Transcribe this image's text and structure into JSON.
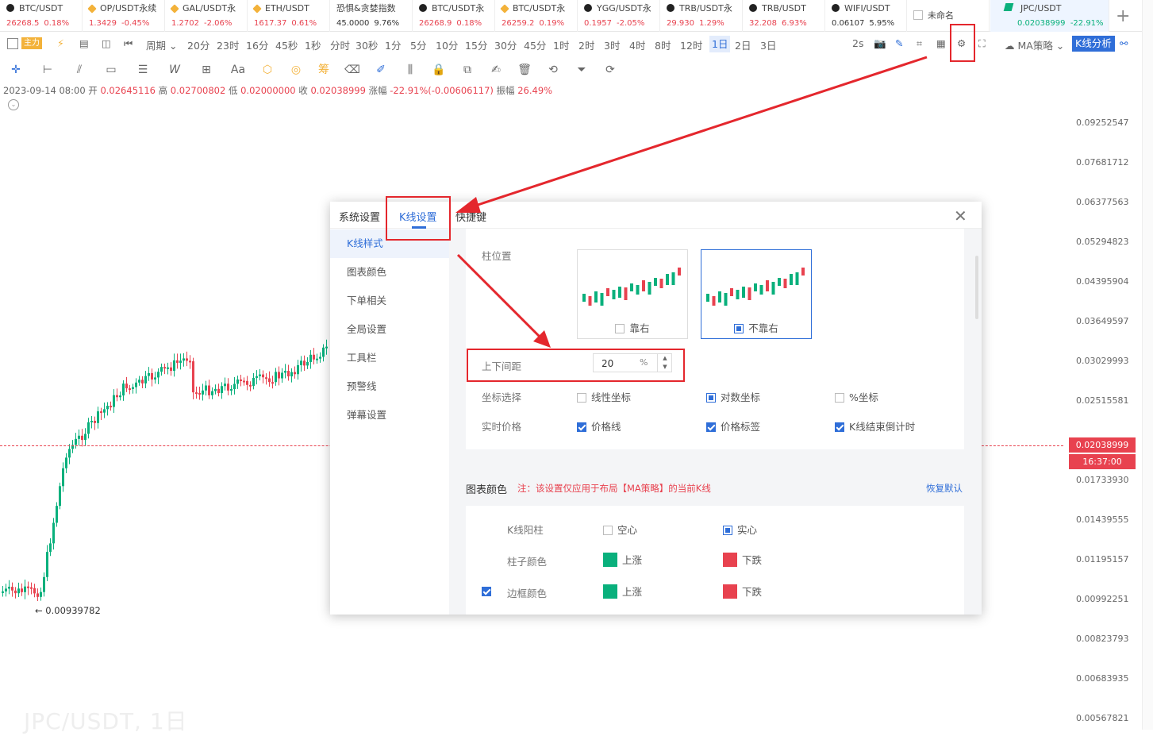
{
  "tickers": [
    {
      "name": "BTC/USDT",
      "price": "26268.5",
      "change": "0.18%",
      "icon": "black",
      "dir": "up"
    },
    {
      "name": "OP/USDT永续",
      "price": "1.3429",
      "change": "-0.45%",
      "icon": "gold",
      "dir": "down"
    },
    {
      "name": "GAL/USDT永",
      "price": "1.2702",
      "change": "-2.06%",
      "icon": "gold",
      "dir": "down"
    },
    {
      "name": "ETH/USDT",
      "price": "1617.37",
      "change": "0.61%",
      "icon": "gold",
      "dir": "up"
    },
    {
      "name": "恐惧&贪婪指数",
      "price": "45.0000",
      "change": "9.76%",
      "icon": "none",
      "dir": "neutral"
    },
    {
      "name": "BTC/USDT永",
      "price": "26268.9",
      "change": "0.18%",
      "icon": "black",
      "dir": "up"
    },
    {
      "name": "BTC/USDT永",
      "price": "26259.2",
      "change": "0.19%",
      "icon": "gold",
      "dir": "up"
    },
    {
      "name": "YGG/USDT永",
      "price": "0.1957",
      "change": "-2.05%",
      "icon": "black",
      "dir": "down"
    },
    {
      "name": "TRB/USDT永",
      "price": "29.930",
      "change": "1.29%",
      "icon": "black",
      "dir": "up"
    },
    {
      "name": "TRB/USDT",
      "price": "32.208",
      "change": "6.93%",
      "icon": "black",
      "dir": "up"
    },
    {
      "name": "WIFI/USDT",
      "price": "0.06107",
      "change": "5.95%",
      "icon": "black",
      "dir": "neutral"
    }
  ],
  "unnamed_label": "未命名",
  "active_ticker": {
    "name": "JPC/USDT",
    "price": "0.02038999",
    "change": "-22.91%"
  },
  "toolbar": {
    "main_badge": "主力",
    "period_label": "周期",
    "intervals": [
      "20分",
      "23时",
      "16分",
      "45秒",
      "1秒",
      "分时",
      "30秒",
      "1分",
      "5分",
      "10分",
      "15分",
      "30分",
      "45分",
      "1时",
      "2时",
      "3时",
      "4时",
      "8时",
      "12时",
      "1日",
      "2日",
      "3日"
    ],
    "selected_interval": "1日",
    "refresh": "2s",
    "strategy": "MA策略",
    "kline_analysis": "K线分析"
  },
  "draw_tools": {
    "text_tool": "Aa",
    "chip_tool": "筹"
  },
  "info": {
    "datetime": "2023-09-14 08:00",
    "open_label": "开",
    "open": "0.02645116",
    "high_label": "高",
    "high": "0.02700802",
    "low_label": "低",
    "low": "0.02000000",
    "close_label": "收",
    "close": "0.02038999",
    "chg_label": "涨幅",
    "chg": "-22.91%(-0.00606117)",
    "amp_label": "振幅",
    "amp": "26.49%"
  },
  "y_axis": [
    "0.09252547",
    "0.07681712",
    "0.06377563",
    "0.05294823",
    "0.04395904",
    "0.03649597",
    "0.03029993",
    "0.02515581",
    "0.01733930",
    "0.01439555",
    "0.01195157",
    "0.00992251",
    "0.00823793",
    "0.00683935",
    "0.00567821"
  ],
  "price_tag": "0.02038999",
  "countdown": "16:37:00",
  "low_marker": "← 0.00939782",
  "watermark": "JPC/USDT, 1日",
  "dialog": {
    "tabs": [
      "系统设置",
      "K线设置",
      "快捷键"
    ],
    "active_tab": "K线设置",
    "sidebar": [
      "K线样式",
      "图表颜色",
      "下单相关",
      "全局设置",
      "工具栏",
      "预警线",
      "弹幕设置"
    ],
    "active_side": "K线样式",
    "bar_position_label": "柱位置",
    "bar_pos_right": "靠右",
    "bar_pos_not_right": "不靠右",
    "spacing_label": "上下间距",
    "spacing_value": "20",
    "spacing_unit": "%",
    "coord_label": "坐标选择",
    "coord_linear": "线性坐标",
    "coord_log": "对数坐标",
    "coord_pct": "%坐标",
    "realtime_label": "实时价格",
    "price_line": "价格线",
    "price_tag": "价格标签",
    "countdown": "K线结束倒计时",
    "chart_color_title": "图表颜色",
    "chart_color_note": "注：该设置仅应用于布局【MA策略】的当前K线",
    "restore": "恢复默认",
    "yang_label": "K线阳柱",
    "hollow": "空心",
    "solid": "实心",
    "bar_color_label": "柱子颜色",
    "border_color_label": "边框颜色",
    "up": "上涨",
    "down": "下跌",
    "up_color": "#09b07c",
    "down_color": "#e8424f"
  }
}
